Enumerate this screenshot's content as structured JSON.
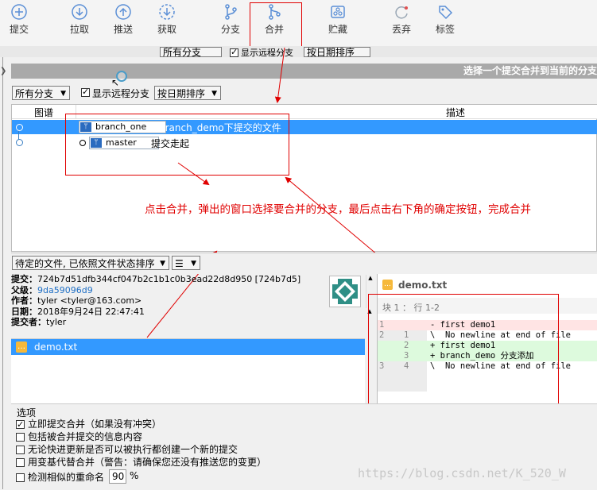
{
  "toolbar": {
    "commit": "提交",
    "pull": "拉取",
    "push": "推送",
    "fetch": "获取",
    "branch": "分支",
    "merge": "合并",
    "stash": "贮藏",
    "discard": "丢弃",
    "tag": "标签"
  },
  "background_bar": {
    "all_branches": "所有分支",
    "show_remote": "显示远程分支",
    "sort_date": "按日期排序"
  },
  "dialog": {
    "title": "选择一个提交合并到当前的分支",
    "branch_filter": "所有分支",
    "show_remote_label": "显示远程分支",
    "show_remote_checked": true,
    "sort_label": "按日期排序",
    "columns": {
      "graph": "图谱",
      "description": "描述"
    },
    "commits": [
      {
        "tag": "branch_one",
        "message": "branch_demo下提交的文件",
        "selected": true
      },
      {
        "tag": "master",
        "message": "提交走起",
        "selected": false
      }
    ],
    "annotation": "点击合并，弹出的窗口选择要合并的分支，最后点击右下角的确定按钮，完成合并",
    "file_sort": "待定的文件, 已依照文件状态排序",
    "details": {
      "commit_label": "提交：",
      "commit_value": "724b7d51dfb344cf047b2c1b1c0b3ead22d8d950 [724b7d5]",
      "parent_label": "父级：",
      "parent_value": "9da59096d9",
      "author_label": "作者：",
      "author_value": "tyler <tyler@163.com>",
      "date_label": "日期：",
      "date_value": "2018年9月24日 22:47:41",
      "committer_label": "提交者：",
      "committer_value": "tyler"
    },
    "files": [
      "demo.txt"
    ],
    "diff": {
      "file": "demo.txt",
      "hunk": "块 1 ：  行 1-2",
      "lines": [
        {
          "old": "1",
          "new": "",
          "text": "- first demo1",
          "kind": "del"
        },
        {
          "old": "2",
          "new": "1",
          "text": "\\  No newline at end of file",
          "kind": "ctx"
        },
        {
          "old": "",
          "new": "2",
          "text": "+ first demo1",
          "kind": "add"
        },
        {
          "old": "",
          "new": "3",
          "text": "+ branch_demo 分支添加",
          "kind": "add"
        },
        {
          "old": "3",
          "new": "4",
          "text": "\\  No newline at end of file",
          "kind": "ctx"
        }
      ]
    },
    "options_title": "选项",
    "options": [
      {
        "label": "立即提交合并（如果没有冲突）",
        "checked": true
      },
      {
        "label": "包括被合并提交的信息内容",
        "checked": false
      },
      {
        "label": "无论快进更新是否可以被执行都创建一个新的提交",
        "checked": false
      },
      {
        "label": "用变基代替合并（警告：请确保您还没有推送您的变更）",
        "checked": false
      },
      {
        "label": "检测相似的重命名",
        "checked": false
      }
    ],
    "rename_value": "90",
    "rename_unit": "%"
  },
  "watermark": "https://blog.csdn.net/K_520_W",
  "colors": {
    "selection": "#3399ff",
    "annotation": "#e00000",
    "hash": "#1f6fc5"
  }
}
